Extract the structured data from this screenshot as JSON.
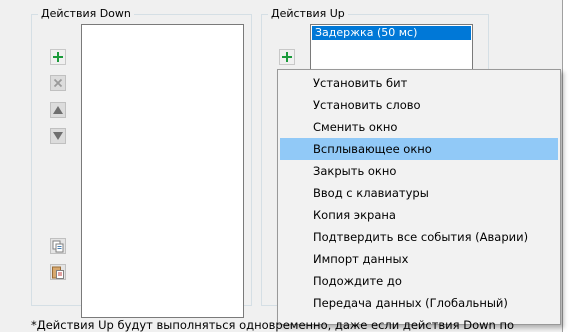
{
  "groups": {
    "down_title": "Действия Down",
    "up_title": "Действия Up"
  },
  "up_list": {
    "items": [
      "Задержка (50 мс)"
    ]
  },
  "context_menu": {
    "items": [
      "Установить бит",
      "Установить слово",
      "Сменить окно",
      "Всплывающее окно",
      "Закрыть окно",
      "Ввод с клавиатуры",
      "Копия экрана",
      "Подтвердить все события  (Аварии)",
      "Импорт данных",
      "Подождите до",
      "Передача данных (Глобальный)"
    ],
    "highlighted_index": 3
  },
  "footnote": "*Действия Up будут выполняться одновременно, даже если действия Down по",
  "icons": {
    "add": "plus-icon",
    "delete": "delete-x-icon",
    "move_up": "arrow-up-icon",
    "move_down": "arrow-down-icon",
    "copy": "copy-icon",
    "paste": "paste-icon"
  },
  "colors": {
    "selection": "#0078d7",
    "menu_highlight": "#91c9f7",
    "add_icon": "#1a9a3a"
  }
}
